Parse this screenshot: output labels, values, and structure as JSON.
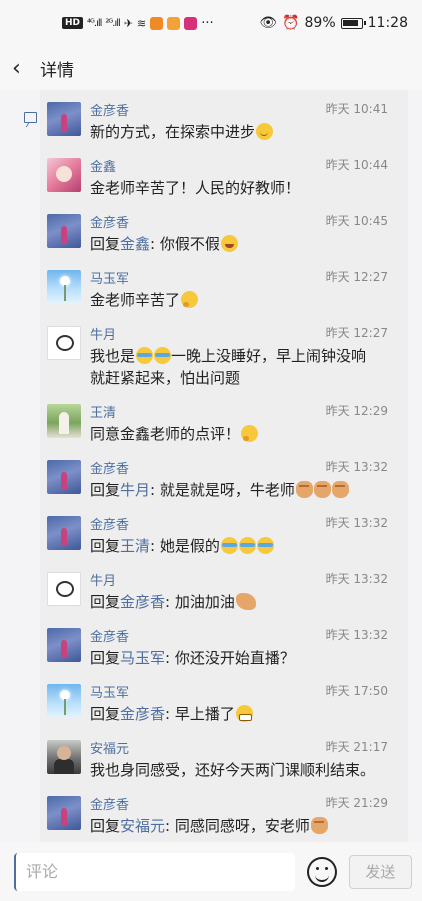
{
  "status_bar": {
    "battery": "89%",
    "time": "11:28"
  },
  "header": {
    "title": "详情"
  },
  "comments": [
    {
      "name": "金彦香",
      "time": "昨天 10:41",
      "text": "新的方式，在探索中进步",
      "emoji": "smile"
    },
    {
      "name": "金鑫",
      "time": "昨天 10:44",
      "text": "金老师辛苦了！人民的好教师！"
    },
    {
      "name": "金彦香",
      "time": "昨天 10:45",
      "reply_prefix": "回复",
      "reply_to": "金鑫",
      "text": ": 你假不假",
      "emoji": "wink"
    },
    {
      "name": "马玉军",
      "time": "昨天 12:27",
      "text": "金老师辛苦了",
      "emoji": "think"
    },
    {
      "name": "牛月",
      "time": "昨天 12:27",
      "text_a": "我也是",
      "text_b": "一晚上没睡好，早上闹钟没响",
      "text_c": "就赶紧起来，怕出问题"
    },
    {
      "name": "王清",
      "time": "昨天 12:29",
      "text": "同意金鑫老师的点评！",
      "emoji": "think"
    },
    {
      "name": "金彦香",
      "time": "昨天 13:32",
      "reply_prefix": "回复",
      "reply_to": "牛月",
      "text": ": 就是就是呀，牛老师"
    },
    {
      "name": "金彦香",
      "time": "昨天 13:32",
      "reply_prefix": "回复",
      "reply_to": "王清",
      "text": ": 她是假的"
    },
    {
      "name": "牛月",
      "time": "昨天 13:32",
      "reply_prefix": "回复",
      "reply_to": "金彦香",
      "text": ": 加油加油"
    },
    {
      "name": "金彦香",
      "time": "昨天 13:32",
      "reply_prefix": "回复",
      "reply_to": "马玉军",
      "text": ": 你还没开始直播？"
    },
    {
      "name": "马玉军",
      "time": "昨天 17:50",
      "reply_prefix": "回复",
      "reply_to": "金彦香",
      "text": ": 早上播了"
    },
    {
      "name": "安福元",
      "time": "昨天 21:17",
      "text": "我也身同感受，还好今天两门课顺利结束。"
    },
    {
      "name": "金彦香",
      "time": "昨天 21:29",
      "reply_prefix": "回复",
      "reply_to": "安福元",
      "text": ": 同感同感呀，安老师"
    }
  ],
  "composer": {
    "placeholder": "评论",
    "send_label": "发送"
  },
  "icons": [
    "back-arrow-icon",
    "comment-icon",
    "emoji-icon"
  ]
}
